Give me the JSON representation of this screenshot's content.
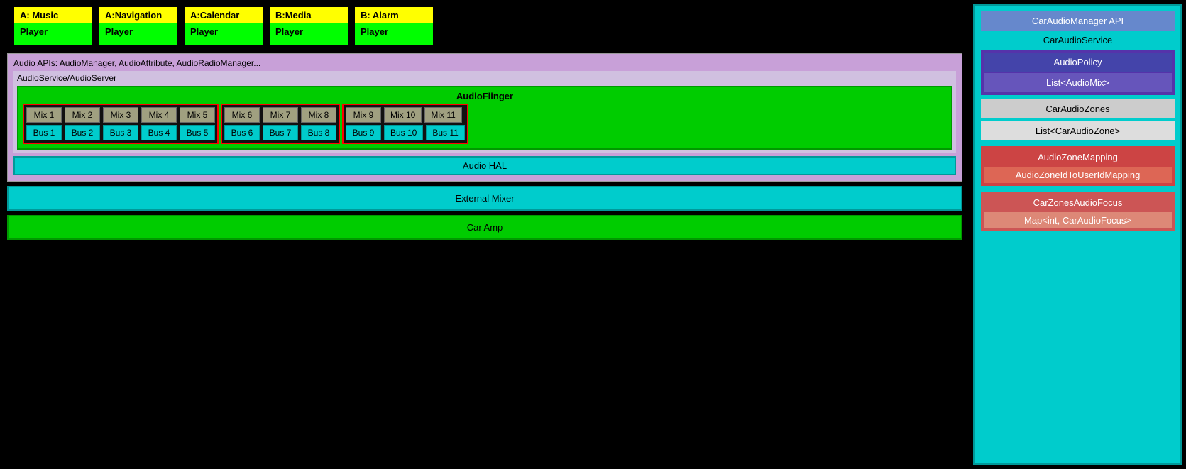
{
  "appPlayers": [
    {
      "label": "A: Music",
      "player": "Player"
    },
    {
      "label": "A:Navigation",
      "player": "Player"
    },
    {
      "label": "A:Calendar",
      "player": "Player"
    },
    {
      "label": "B:Media",
      "player": "Player"
    },
    {
      "label": "B: Alarm",
      "player": "Player"
    }
  ],
  "layers": {
    "audioApis": "Audio APIs: AudioManager, AudioAttribute, AudioRadioManager...",
    "audioService": "AudioService/AudioServer",
    "audioFlinger": "AudioFlinger",
    "audioHal": "Audio HAL",
    "externalMixer": "External Mixer",
    "carAmp": "Car Amp"
  },
  "mixBuses": {
    "zone1": {
      "mixes": [
        "Mix 1",
        "Mix 2",
        "Mix 3",
        "Mix 4",
        "Mix 5"
      ],
      "buses": [
        "Bus 1",
        "Bus 2",
        "Bus 3",
        "Bus 4",
        "Bus 5"
      ]
    },
    "zone2": {
      "mixes": [
        "Mix 6",
        "Mix 7",
        "Mix 8"
      ],
      "buses": [
        "Bus 6",
        "Bus 7",
        "Bus 8"
      ]
    },
    "zone3": {
      "mixes": [
        "Mix 9",
        "Mix 10",
        "Mix 11"
      ],
      "buses": [
        "Bus 9",
        "Bus 10",
        "Bus 11"
      ]
    }
  },
  "rightPanel": {
    "carAudioManagerApi": "CarAudioManager API",
    "carAudioService": "CarAudioService",
    "audioPolicy": "AudioPolicy",
    "listAudioMix": "List<AudioMix>",
    "carAudioZones": "CarAudioZones",
    "listCarAudioZone": "List<CarAudioZone>",
    "audioZoneMapping": "AudioZoneMapping",
    "audioZoneIdToUserIdMapping": "AudioZoneIdToUserIdMapping",
    "carZonesAudioFocus": "CarZonesAudioFocus",
    "mapIntCarAudioFocus": "Map<int, CarAudioFocus>"
  }
}
